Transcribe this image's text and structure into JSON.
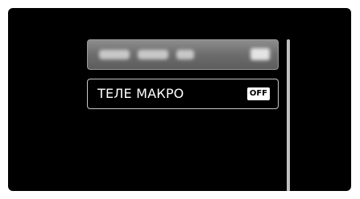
{
  "menu": {
    "items": [
      {
        "label": "",
        "blurred": true
      },
      {
        "label": "ТЕЛЕ МАКРО",
        "value": "OFF",
        "selected": true
      }
    ]
  },
  "colors": {
    "screen_background": "#000000",
    "item_border": "#9a9a9a",
    "badge_background": "#ffffff",
    "text": "#ffffff"
  }
}
